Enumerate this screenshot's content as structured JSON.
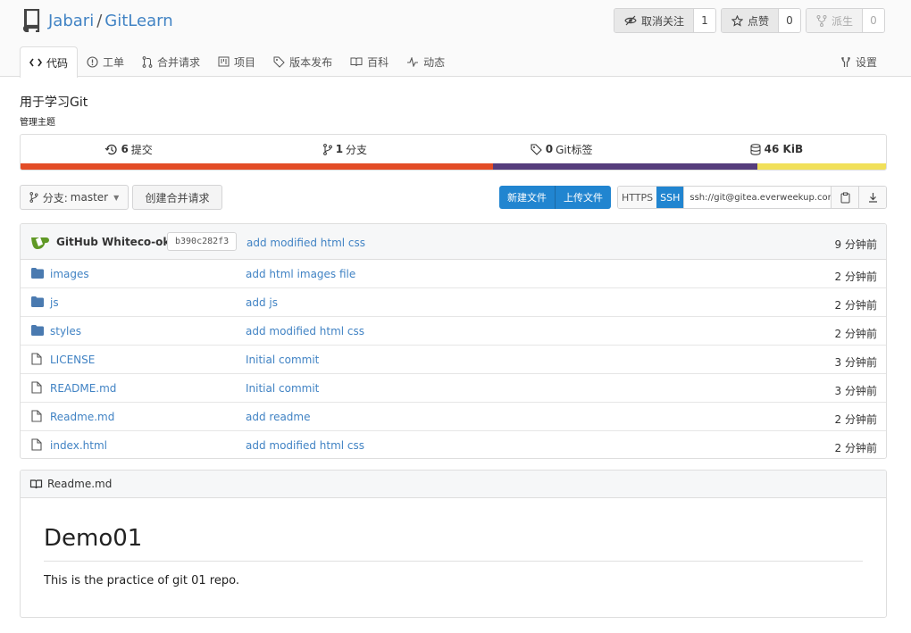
{
  "repo": {
    "owner": "Jabari",
    "separator": "/",
    "name": "GitLearn",
    "description": "用于学习Git",
    "topics_label": "管理主题"
  },
  "actions": {
    "watch": {
      "label": "取消关注",
      "count": "1"
    },
    "star": {
      "label": "点赞",
      "count": "0"
    },
    "fork": {
      "label": "派生",
      "count": "0"
    }
  },
  "tabs": [
    {
      "label": "代码",
      "icon": "code-icon",
      "active": true
    },
    {
      "label": "工单",
      "icon": "issue-icon"
    },
    {
      "label": "合并请求",
      "icon": "pull-request-icon"
    },
    {
      "label": "项目",
      "icon": "project-icon"
    },
    {
      "label": "版本发布",
      "icon": "tag-icon"
    },
    {
      "label": "百科",
      "icon": "book-icon"
    },
    {
      "label": "动态",
      "icon": "activity-icon"
    }
  ],
  "settings_label": "设置",
  "stats": [
    {
      "value": "6",
      "label": "提交",
      "icon": "history-icon"
    },
    {
      "value": "1",
      "label": "分支",
      "icon": "branch-icon"
    },
    {
      "value": "0",
      "label": "Git标签",
      "icon": "tag-icon"
    },
    {
      "value": "46 KiB",
      "label": "",
      "icon": "database-icon"
    }
  ],
  "language_bar": [
    {
      "color": "#e34c26",
      "percent": 54.6
    },
    {
      "color": "#563d7c",
      "percent": 30.5
    },
    {
      "color": "#f1e05a",
      "percent": 14.9
    }
  ],
  "branch": {
    "prefix": "分支:",
    "name": "master"
  },
  "new_pr_label": "创建合并请求",
  "file_buttons": {
    "new_file": "新建文件",
    "upload": "上传文件"
  },
  "clone": {
    "https": "HTTPS",
    "ssh": "SSH",
    "url": "ssh://git@gitea.everweekup.com"
  },
  "latest_commit": {
    "author": "GitHub Whiteco-okie",
    "sha": "b390c282f3",
    "message": "add modified html css",
    "age": "9 分钟前"
  },
  "files": [
    {
      "type": "dir",
      "name": "images",
      "message": "add html images file",
      "age": "2 分钟前"
    },
    {
      "type": "dir",
      "name": "js",
      "message": "add js",
      "age": "2 分钟前"
    },
    {
      "type": "dir",
      "name": "styles",
      "message": "add modified html css",
      "age": "2 分钟前"
    },
    {
      "type": "file",
      "name": "LICENSE",
      "message": "Initial commit",
      "age": "3 分钟前"
    },
    {
      "type": "file",
      "name": "README.md",
      "message": "Initial commit",
      "age": "3 分钟前"
    },
    {
      "type": "file",
      "name": "Readme.md",
      "message": "add readme",
      "age": "2 分钟前"
    },
    {
      "type": "file",
      "name": "index.html",
      "message": "add modified html css",
      "age": "2 分钟前"
    }
  ],
  "readme": {
    "filename": "Readme.md",
    "heading": "Demo01",
    "body": "This is the practice of git 01 repo."
  }
}
